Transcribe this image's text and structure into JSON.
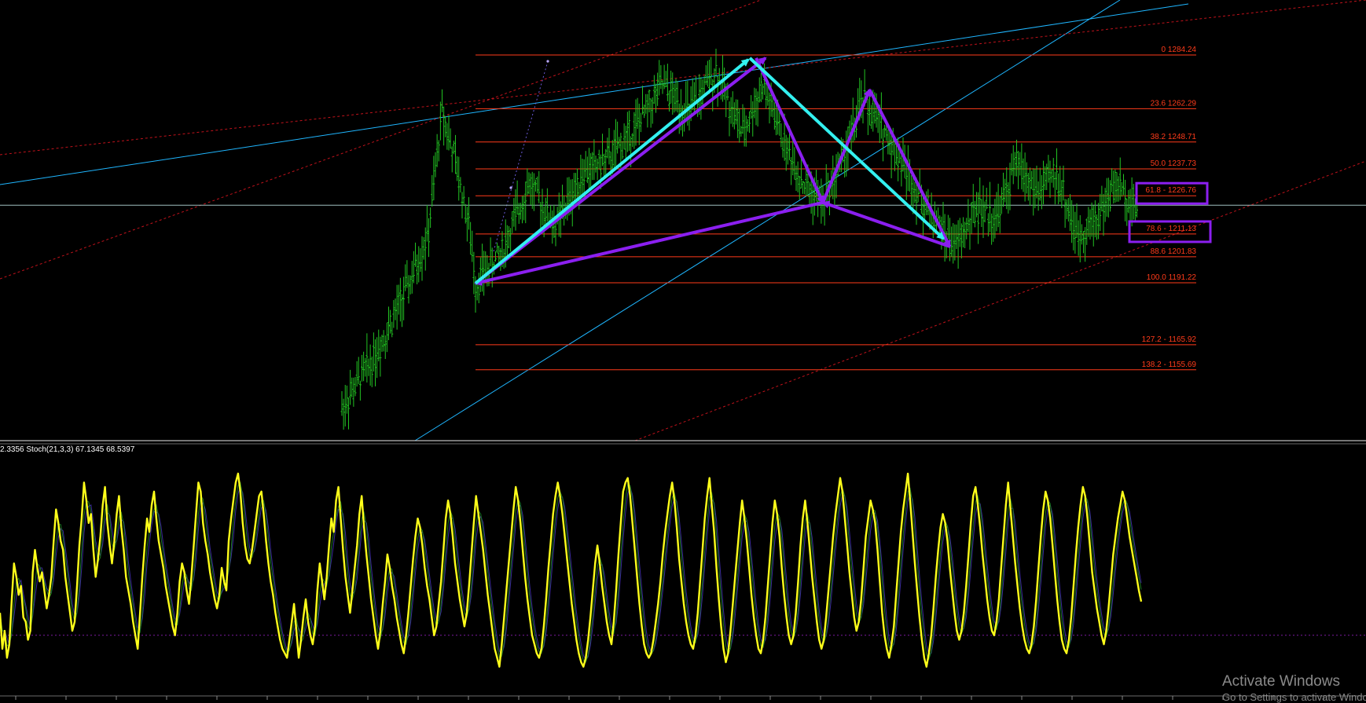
{
  "chart_data": [
    {
      "type": "line",
      "subtype": "candlestick-price-with-fibonacci",
      "grid": false,
      "background": "#000000",
      "colors": {
        "bars": "#22c322",
        "fib_lines": "#ff3b1a",
        "fib_text": "#ff3b1a",
        "trend_blue": "#1fb6ff",
        "trend_red_dotted": "#c0121b",
        "harmonic_arrow_cyan": "#33f0f0",
        "harmonic_arrow_purple": "#8b1ff0",
        "highlight_box": "#8b1ff0",
        "current_price_line": "#9fbfc0"
      },
      "fib_levels": [
        {
          "text": "0 1284.24",
          "level": 0,
          "price": 1284.24
        },
        {
          "text": "23.6 1262.29",
          "level": 23.6,
          "price": 1262.29
        },
        {
          "text": "38.2 1248.71",
          "level": 38.2,
          "price": 1248.71
        },
        {
          "text": "50.0 1237.73",
          "level": 50.0,
          "price": 1237.73
        },
        {
          "text": "61.8 - 1226.76",
          "level": 61.8,
          "price": 1226.76
        },
        {
          "text": "78.6 - 1211.13",
          "level": 78.6,
          "price": 1211.13
        },
        {
          "text": "88.6 1201.83",
          "level": 88.6,
          "price": 1201.83
        },
        {
          "text": "100.0 1191.22",
          "level": 100.0,
          "price": 1191.22
        },
        {
          "text": "127.2 - 1165.92",
          "level": 127.2,
          "price": 1165.92
        },
        {
          "text": "138.2 - 1155.69",
          "level": 138.2,
          "price": 1155.69
        }
      ],
      "highlighted_levels": [
        61.8,
        78.6
      ],
      "harmonic_points": [
        {
          "bar": 0,
          "price": 1191.0
        },
        {
          "bar": 42,
          "price": 1283.0
        },
        {
          "bar": 52,
          "price": 1224.0
        },
        {
          "bar": 59,
          "price": 1270.0
        },
        {
          "bar": 71,
          "price": 1206.0
        }
      ],
      "price_range": [
        1150,
        1320
      ],
      "price_path": [
        [
          -20,
          1140
        ],
        [
          -15,
          1162
        ],
        [
          -10,
          1190
        ],
        [
          -7,
          1212
        ],
        [
          -5,
          1262
        ],
        [
          -3,
          1240
        ],
        [
          -1,
          1215
        ],
        [
          0,
          1191
        ],
        [
          4,
          1204
        ],
        [
          8,
          1232
        ],
        [
          12,
          1214
        ],
        [
          16,
          1236
        ],
        [
          20,
          1242
        ],
        [
          24,
          1255
        ],
        [
          28,
          1272
        ],
        [
          32,
          1260
        ],
        [
          36,
          1278
        ],
        [
          40,
          1252
        ],
        [
          43,
          1272
        ],
        [
          46,
          1250
        ],
        [
          49,
          1232
        ],
        [
          52,
          1224
        ],
        [
          55,
          1242
        ],
        [
          58,
          1266
        ],
        [
          61,
          1254
        ],
        [
          64,
          1240
        ],
        [
          67,
          1224
        ],
        [
          70,
          1212
        ],
        [
          72,
          1206
        ],
        [
          75,
          1222
        ],
        [
          78,
          1218
        ],
        [
          81,
          1240
        ],
        [
          84,
          1228
        ],
        [
          87,
          1236
        ],
        [
          90,
          1210
        ],
        [
          93,
          1218
        ],
        [
          96,
          1232
        ],
        [
          99,
          1222
        ]
      ]
    },
    {
      "type": "line",
      "subtype": "stochastic-oscillator",
      "label": "2.3356  Stoch(21,3,3) 67.1345 68.5397",
      "ylim": [
        0,
        100
      ],
      "colors": {
        "main": "#ffff1a",
        "signal": "#1d7a1d",
        "signal2": "#3a2a9a",
        "level": "#7a1aa0"
      },
      "series": [
        {
          "values": [
            30,
            14,
            22,
            10,
            16,
            35,
            52,
            46,
            38,
            42,
            28,
            26,
            18,
            22,
            48,
            58,
            50,
            44,
            48,
            40,
            32,
            38,
            46,
            62,
            76,
            70,
            62,
            58,
            46,
            38,
            30,
            22,
            26,
            42,
            60,
            72,
            88,
            80,
            70,
            74,
            58,
            46,
            54,
            64,
            78,
            86,
            70,
            60,
            52,
            62,
            74,
            82,
            68,
            58,
            46,
            40,
            34,
            26,
            20,
            14,
            30,
            46,
            60,
            72,
            66,
            78,
            84,
            72,
            62,
            56,
            50,
            42,
            36,
            30,
            24,
            20,
            30,
            44,
            52,
            48,
            40,
            34,
            46,
            60,
            74,
            88,
            84,
            70,
            62,
            56,
            48,
            42,
            36,
            32,
            38,
            50,
            44,
            40,
            62,
            72,
            80,
            88,
            92,
            84,
            70,
            60,
            54,
            52,
            58,
            66,
            74,
            82,
            84,
            74,
            62,
            52,
            44,
            38,
            30,
            24,
            18,
            14,
            12,
            10,
            18,
            26,
            34,
            22,
            10,
            18,
            28,
            36,
            26,
            20,
            16,
            24,
            40,
            52,
            44,
            36,
            46,
            60,
            72,
            66,
            80,
            86,
            72,
            58,
            46,
            38,
            30,
            40,
            50,
            60,
            74,
            82,
            68,
            56,
            46,
            36,
            28,
            20,
            14,
            22,
            34,
            44,
            56,
            50,
            42,
            36,
            28,
            22,
            16,
            12,
            20,
            30,
            42,
            54,
            64,
            72,
            68,
            60,
            50,
            42,
            36,
            28,
            20,
            24,
            34,
            44,
            58,
            72,
            80,
            74,
            64,
            52,
            44,
            36,
            30,
            24,
            30,
            42,
            56,
            70,
            82,
            74,
            66,
            58,
            48,
            38,
            30,
            22,
            14,
            10,
            6,
            16,
            28,
            40,
            52,
            64,
            76,
            86,
            80,
            70,
            58,
            46,
            36,
            28,
            20,
            16,
            12,
            10,
            14,
            24,
            36,
            50,
            62,
            74,
            82,
            88,
            82,
            74,
            64,
            54,
            44,
            34,
            26,
            18,
            12,
            8,
            6,
            10,
            18,
            28,
            40,
            52,
            60,
            52,
            42,
            34,
            26,
            20,
            16,
            26,
            40,
            56,
            70,
            84,
            88,
            90,
            82,
            70,
            58,
            46,
            34,
            24,
            16,
            12,
            10,
            12,
            18,
            26,
            34,
            44,
            56,
            66,
            74,
            82,
            88,
            80,
            68,
            54,
            44,
            34,
            26,
            20,
            16,
            14,
            20,
            30,
            44,
            58,
            72,
            82,
            90,
            78,
            66,
            50,
            36,
            24,
            14,
            8,
            12,
            22,
            34,
            46,
            58,
            70,
            80,
            72,
            62,
            50,
            38,
            28,
            20,
            14,
            12,
            18,
            28,
            42,
            56,
            70,
            80,
            74,
            64,
            50,
            38,
            28,
            20,
            16,
            20,
            30,
            44,
            60,
            72,
            80,
            70,
            58,
            46,
            36,
            26,
            18,
            14,
            18,
            28,
            40,
            52,
            64,
            74,
            82,
            90,
            84,
            72,
            60,
            48,
            38,
            28,
            22,
            26,
            36,
            50,
            64,
            72,
            80,
            76,
            70,
            58,
            44,
            30,
            20,
            14,
            10,
            16,
            24,
            38,
            52,
            66,
            76,
            84,
            92,
            80,
            66,
            52,
            40,
            28,
            18,
            10,
            6,
            12,
            20,
            32,
            46,
            58,
            68,
            74,
            70,
            62,
            50,
            40,
            30,
            22,
            18,
            22,
            30,
            42,
            56,
            70,
            82,
            86,
            78,
            68,
            56,
            46,
            36,
            28,
            22,
            20,
            26,
            36,
            50,
            64,
            78,
            88,
            76,
            64,
            52,
            42,
            32,
            24,
            18,
            14,
            12,
            16,
            24,
            36,
            50,
            64,
            76,
            84,
            80,
            72,
            60,
            48,
            36,
            26,
            18,
            14,
            12,
            18,
            28,
            42,
            56,
            68,
            78,
            86,
            82,
            72,
            60,
            48,
            40,
            32,
            26,
            20,
            16,
            22,
            32,
            44,
            56,
            64,
            72,
            78,
            84,
            80,
            72,
            64,
            58,
            52,
            46,
            40,
            35
          ]
        }
      ]
    }
  ],
  "watermark": {
    "title": "Activate Windows",
    "subtitle": "Go to Settings to activate Windows."
  }
}
